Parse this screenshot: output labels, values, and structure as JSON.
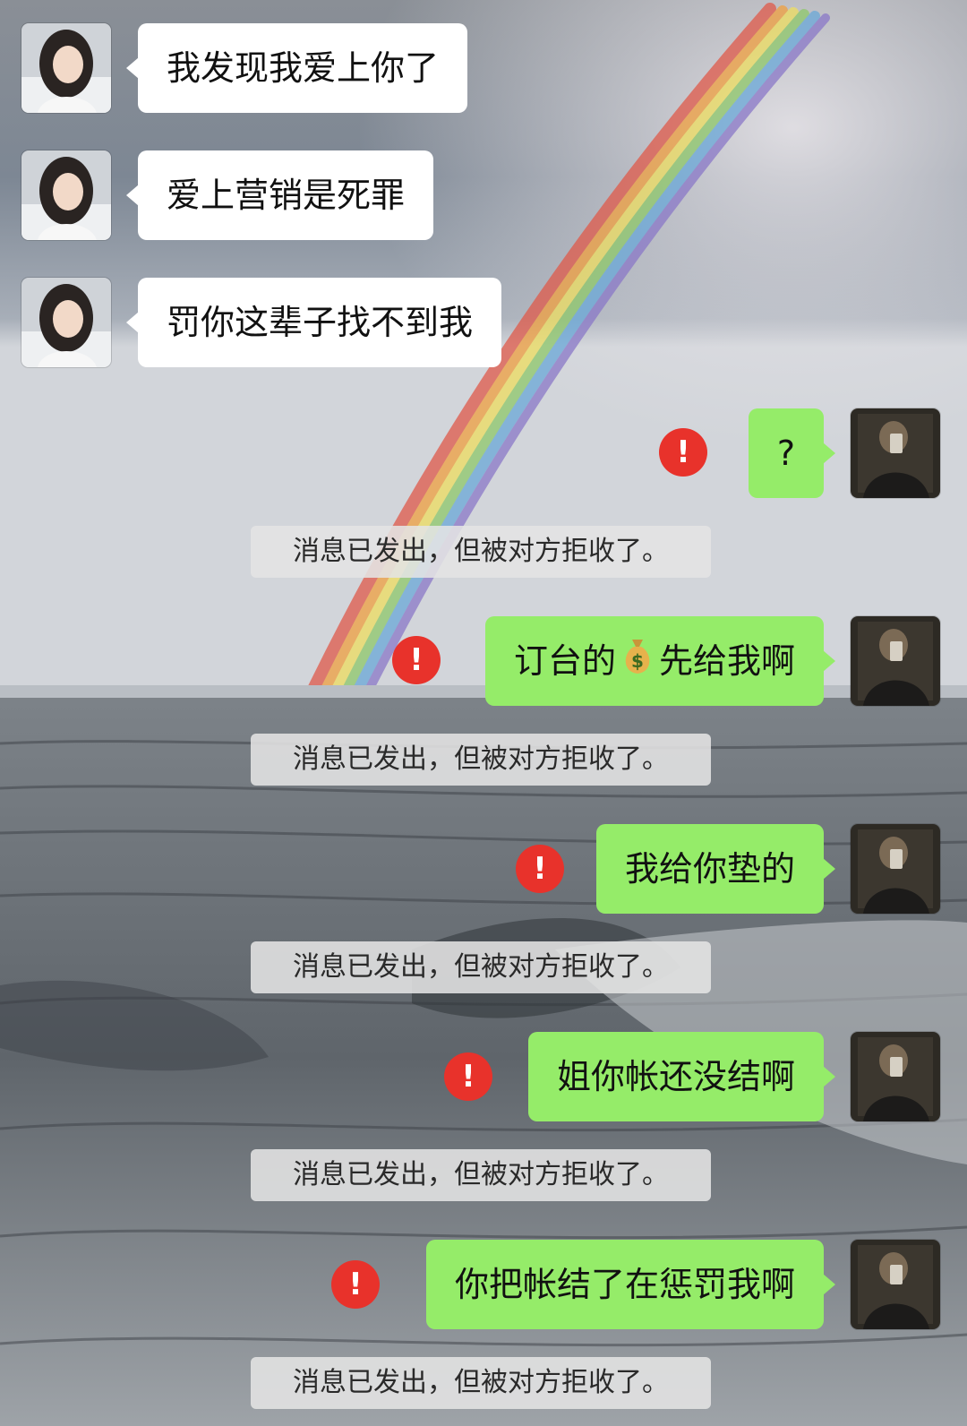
{
  "contacts": {
    "other": {
      "avatar_icon": "woman-portrait-avatar"
    },
    "me": {
      "avatar_icon": "man-selfie-avatar"
    }
  },
  "messages": [
    {
      "from": "other",
      "text": "我发现我爱上你了"
    },
    {
      "from": "other",
      "text": "爱上营销是死罪"
    },
    {
      "from": "other",
      "text": "罚你这辈子找不到我"
    },
    {
      "from": "me",
      "text": "?",
      "status": "rejected",
      "notice": "消息已发出，但被对方拒收了。"
    },
    {
      "from": "me",
      "text_before": "订台的",
      "emoji": "money-bag-emoji",
      "text_after": "先给我啊",
      "status": "rejected",
      "notice": "消息已发出，但被对方拒收了。"
    },
    {
      "from": "me",
      "text": "我给你垫的",
      "status": "rejected",
      "notice": "消息已发出，但被对方拒收了。"
    },
    {
      "from": "me",
      "text": "姐你帐还没结啊",
      "status": "rejected",
      "notice": "消息已发出，但被对方拒收了。"
    },
    {
      "from": "me",
      "text": "你把帐结了在惩罚我啊",
      "status": "rejected",
      "notice": "消息已发出，但被对方拒收了。"
    }
  ],
  "status_icon": {
    "symbol": "!",
    "color": "#e8322b"
  },
  "colors": {
    "incoming_bubble": "#ffffff",
    "outgoing_bubble": "#95ec69"
  },
  "background": {
    "description_icon": "rainbow-over-frozen-lake-wallpaper"
  }
}
